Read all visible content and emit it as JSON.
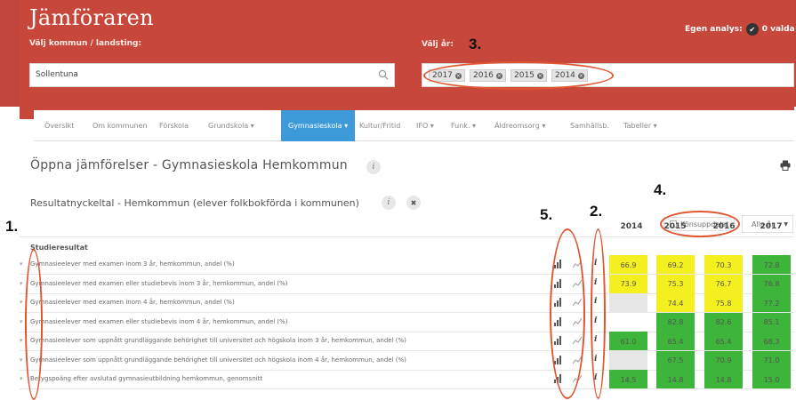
{
  "header": {
    "title": "Jämföraren",
    "kommun_label": "Välj kommun / landsting:",
    "year_label": "Välj år:",
    "search_value": "Sollentuna",
    "egen_analys": "Egen analys:",
    "valda": "0 valda",
    "years": [
      "2017",
      "2016",
      "2015",
      "2014"
    ]
  },
  "nav": {
    "items": [
      "Översikt",
      "Om kommunen",
      "Förskola",
      "Grundskola ▾",
      "Gymnasieskola ▾",
      "Kultur/Fritid",
      "IFO ▾",
      "Funk. ▾",
      "Äldreomsorg ▾",
      "Samhällsb.",
      "Tabeller ▾"
    ],
    "active_index": 4
  },
  "page": {
    "title": "Öppna jämförelser - Gymnasieskola Hemkommun",
    "section_title": "Resultatnyckeltal - Hemkommun (elever folkbokförda i kommunen)",
    "kon_label": "Könsuppdelat",
    "year_select": "Alla år",
    "group_label": "Studieresultat",
    "columns": [
      "2014",
      "2015",
      "2016",
      "2017"
    ]
  },
  "rows": [
    {
      "label": "Gymnasieelever med examen inom 3 år, hemkommun, andel (%)",
      "values": [
        "66.9",
        "69.2",
        "70.3",
        "72.8"
      ],
      "colors": [
        "#f4f01f",
        "#f4f01f",
        "#f4f01f",
        "#3db43a"
      ]
    },
    {
      "label": "Gymnasieelever med examen eller studiebevis inom 3 år, hemkommun, andel (%)",
      "values": [
        "73.9",
        "75.3",
        "76.7",
        "76.8"
      ],
      "colors": [
        "#f4f01f",
        "#f4f01f",
        "#f4f01f",
        "#3db43a"
      ]
    },
    {
      "label": "Gymnasieelever med examen inom 4 år, hemkommun, andel (%)",
      "values": [
        "",
        "74.4",
        "75.8",
        "77.2"
      ],
      "colors": [
        "#e6e6e6",
        "#f4f01f",
        "#f4f01f",
        "#3db43a"
      ]
    },
    {
      "label": "Gymnasieelever med examen eller studiebevis inom 4 år, hemkommun, andel (%)",
      "values": [
        "",
        "82.8",
        "82.6",
        "85.1"
      ],
      "colors": [
        "#ffffff",
        "#3db43a",
        "#3db43a",
        "#3db43a"
      ]
    },
    {
      "label": "Gymnasieelever som uppnått grundläggande behörighet till universitet och högskola inom 3 år, hemkommun, andel (%)",
      "values": [
        "61.0",
        "65.4",
        "65.4",
        "68.3"
      ],
      "colors": [
        "#3db43a",
        "#3db43a",
        "#3db43a",
        "#3db43a"
      ]
    },
    {
      "label": "Gymnasieelever som uppnått grundläggande behörighet till universitet och högskola inom 4 år, hemkommun, andel (%)",
      "values": [
        "",
        "67.5",
        "70.9",
        "71.0"
      ],
      "colors": [
        "#e6e6e6",
        "#3db43a",
        "#3db43a",
        "#3db43a"
      ]
    },
    {
      "label": "Betygspoäng efter avslutad gymnasieutbildning hemkommun, genomsnitt",
      "values": [
        "14.5",
        "14.8",
        "14.8",
        "15.0"
      ],
      "colors": [
        "#3db43a",
        "#3db43a",
        "#3db43a",
        "#3db43a"
      ]
    }
  ],
  "annotations": [
    "1.",
    "2.",
    "3.",
    "4.",
    "5."
  ],
  "colors": {
    "header": "#c8473b",
    "nav_active": "#3d9ad8",
    "yellow": "#f4f01f",
    "green": "#3db43a",
    "ring": "#e0552f"
  }
}
